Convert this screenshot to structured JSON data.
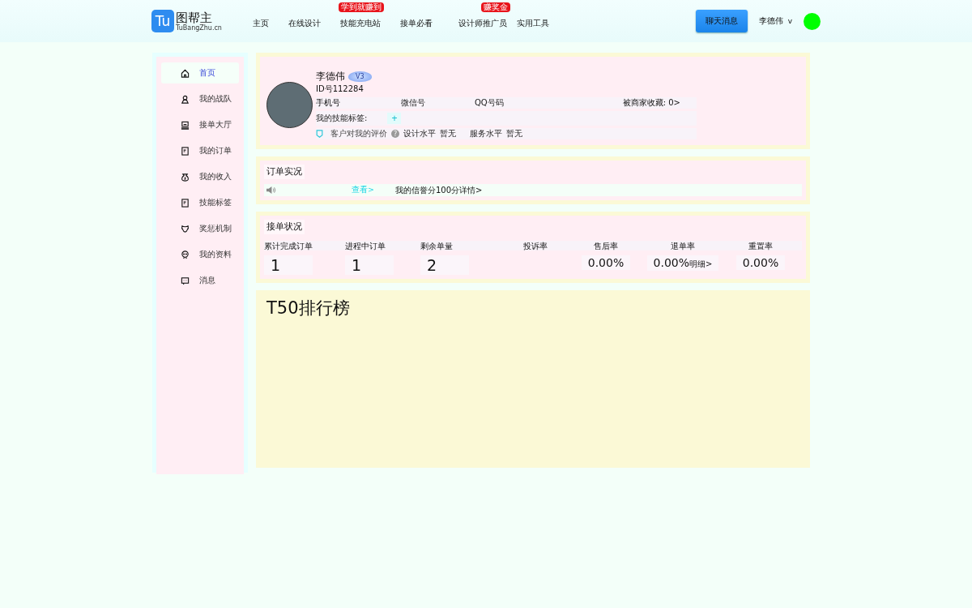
{
  "header": {
    "logo_mark": "Tu",
    "logo_name": "图帮主",
    "logo_domain": "TuBangZhu.cn",
    "nav": [
      {
        "label": "主页"
      },
      {
        "label": "在线设计"
      },
      {
        "label": "技能充电站",
        "badge": "学到就赚到"
      },
      {
        "label": "接单必看"
      },
      {
        "label": "设计师推广员",
        "badge": "赚奖金"
      },
      {
        "label": "实用工具"
      }
    ],
    "chat_button": "聊天消息",
    "user_name": "李德伟",
    "caret": "v"
  },
  "sidebar": {
    "items": [
      {
        "label": "首页",
        "selected": true
      },
      {
        "label": "我的战队",
        "selected": false
      },
      {
        "label": "接单大厅",
        "selected": false
      },
      {
        "label": "我的订单",
        "selected": false
      },
      {
        "label": "我的收入",
        "selected": false
      },
      {
        "label": "技能标签",
        "selected": false
      },
      {
        "label": "奖惩机制",
        "selected": false
      },
      {
        "label": "我的资料",
        "selected": false
      },
      {
        "label": "消息",
        "selected": false
      }
    ]
  },
  "profile": {
    "name": "李德伟",
    "level": "V3",
    "id": "ID号112284",
    "phone_label": "手机号",
    "wechat_label": "微信号",
    "qq_label": "QQ号码",
    "favorites": "被商家收藏: 0>",
    "tags_label": "我的技能标签:",
    "add": "+",
    "review_label": "客户对我的评价",
    "help": "?",
    "design_label": "设计水平",
    "design_value": "暂无",
    "service_label": "服务水平",
    "service_value": "暂无"
  },
  "orders": {
    "title": "订单实况",
    "view_link": "查看>",
    "credit": "我的信誉分100分详情>"
  },
  "status": {
    "title": "接单状况",
    "stats": [
      {
        "label": "累计完成订单",
        "value": "1"
      },
      {
        "label": "进程中订单",
        "value": "1"
      },
      {
        "label": "剩余单量",
        "value": "2"
      },
      {
        "label": "投诉率"
      },
      {
        "label": "售后率",
        "value": "0.00%"
      },
      {
        "label": "退单率",
        "value": "0.00%",
        "link": "明细>"
      },
      {
        "label": "重置率",
        "value": "0.00%"
      }
    ]
  },
  "ranking": {
    "title": "T50排行榜"
  }
}
